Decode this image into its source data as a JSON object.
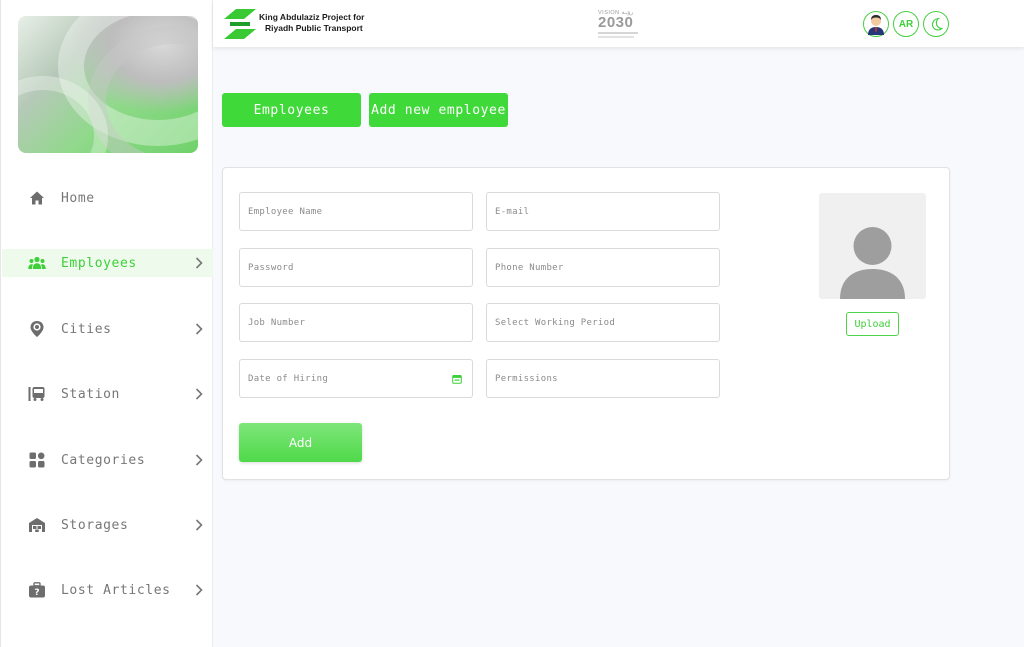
{
  "header": {
    "brand_line1": "King Abdulaziz Project for",
    "brand_line2": "Riyadh Public Transport",
    "vision_top": "VISION رؤيـة",
    "vision_number": "2030",
    "lang_label": "AR"
  },
  "sidebar": {
    "items": [
      {
        "label": "Home",
        "icon": "home-icon"
      },
      {
        "label": "Employees",
        "icon": "users-icon",
        "active": true
      },
      {
        "label": "Cities",
        "icon": "map-pin-icon"
      },
      {
        "label": "Station",
        "icon": "bus-icon"
      },
      {
        "label": "Categories",
        "icon": "grid-icon"
      },
      {
        "label": "Storages",
        "icon": "warehouse-icon"
      },
      {
        "label": "Lost Articles",
        "icon": "lost-bag-icon"
      }
    ]
  },
  "tabs": {
    "employees": "Employees",
    "add_new": "Add new employee"
  },
  "form": {
    "employee_name": "Employee Name",
    "email": "E-mail",
    "password": "Password",
    "phone": "Phone Number",
    "job_number": "Job Number",
    "working_period": "Select Working Period",
    "date_of_hiring": "Date of Hiring",
    "permissions": "Permissions",
    "add_label": "Add",
    "upload_label": "Upload"
  },
  "colors": {
    "accent": "#3fd93a",
    "active_bg": "#eefbec"
  }
}
